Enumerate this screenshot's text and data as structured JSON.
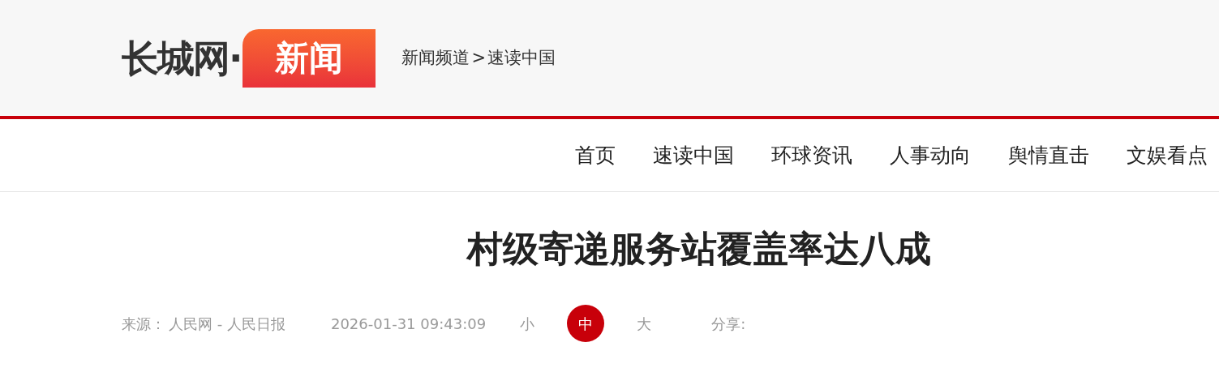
{
  "logo": {
    "site": "长城网·",
    "channel": "新闻"
  },
  "breadcrumb": {
    "items": [
      "新闻频道",
      "速读中国"
    ],
    "separator": ">"
  },
  "nav": [
    {
      "label": "首页"
    },
    {
      "label": "速读中国"
    },
    {
      "label": "环球资讯"
    },
    {
      "label": "人事动向"
    },
    {
      "label": "舆情直击"
    },
    {
      "label": "文娱看点"
    }
  ],
  "article": {
    "title": "村级寄递服务站覆盖率达八成",
    "source_label": "来源：",
    "source": "人民网 - 人民日报",
    "time": "2026-01-31 09:43:09",
    "font_sizes": [
      {
        "label": "小",
        "selected": false
      },
      {
        "label": "中",
        "selected": true
      },
      {
        "label": "大",
        "selected": false
      }
    ],
    "share_label": "分享:"
  }
}
